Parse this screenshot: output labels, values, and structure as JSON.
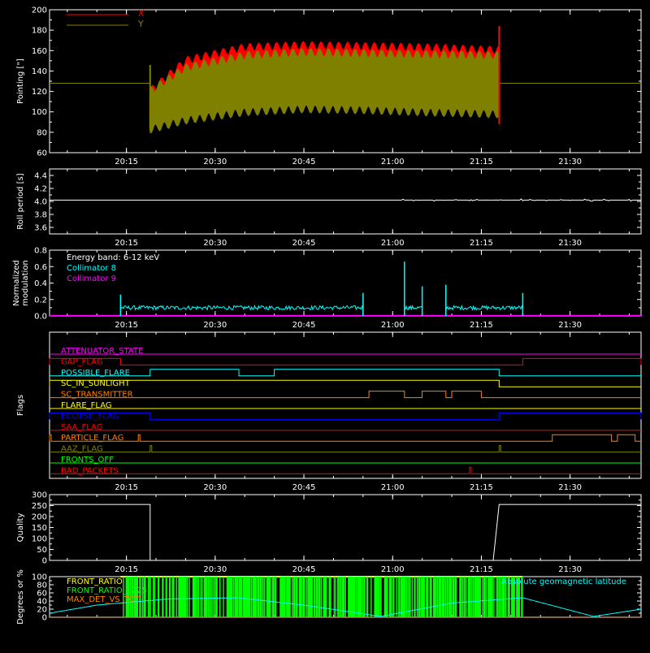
{
  "chart_data": [
    {
      "id": "pointing",
      "type": "line",
      "ylabel": "Pointing [\"]",
      "ylim": [
        60,
        200
      ],
      "yticks": [
        60,
        80,
        100,
        120,
        140,
        160,
        180,
        200
      ],
      "xlim": [
        "20:02",
        "21:42"
      ],
      "xticks": [
        "20:15",
        "20:30",
        "20:45",
        "21:00",
        "21:15",
        "21:30"
      ],
      "legend_placement": "top-left",
      "legend": [
        {
          "label": "X",
          "color": "#ff0000"
        },
        {
          "label": "Y",
          "color": "#808000"
        }
      ],
      "baseline_y": 128,
      "data_window": [
        "20:19",
        "21:18"
      ],
      "series": [
        {
          "name": "X",
          "color": "#ff0000",
          "envelope": {
            "time": [
              "20:19",
              "20:25",
              "20:35",
              "20:45",
              "20:55",
              "21:05",
              "21:18"
            ],
            "upper": [
              120,
              150,
              163,
              165,
              164,
              163,
              160
            ],
            "lower": [
              92,
              103,
              112,
              115,
              114,
              114,
              113
            ]
          }
        },
        {
          "name": "Y",
          "color": "#808000",
          "envelope": {
            "time": [
              "20:19",
              "20:25",
              "20:35",
              "20:45",
              "20:55",
              "21:05",
              "21:18"
            ],
            "upper": [
              120,
              143,
              155,
              158,
              157,
              156,
              155
            ],
            "lower": [
              83,
              92,
              100,
              103,
              102,
              100,
              98
            ]
          }
        }
      ]
    },
    {
      "id": "roll",
      "type": "line",
      "ylabel": "Roll period [s]",
      "ylim": [
        3.5,
        4.5
      ],
      "yticks": [
        3.6,
        3.8,
        4.0,
        4.2,
        4.4
      ],
      "xticks": [
        "20:15",
        "20:30",
        "20:45",
        "21:00",
        "21:15",
        "21:30"
      ],
      "series": [
        {
          "name": "",
          "color": "#ffffff",
          "constant_value": 4.02,
          "time_range": [
            "20:02",
            "21:42"
          ]
        }
      ]
    },
    {
      "id": "modulation",
      "type": "line",
      "ylabel": "Normalized modulation",
      "ylim": [
        0,
        0.8
      ],
      "yticks": [
        0.0,
        0.2,
        0.4,
        0.6,
        0.8
      ],
      "xticks": [
        "20:15",
        "20:30",
        "20:45",
        "21:00",
        "21:15",
        "21:30"
      ],
      "annotations": [
        "Energy band: 6-12 keV"
      ],
      "legend": [
        {
          "label": "Collimator 8",
          "color": "#00ffff"
        },
        {
          "label": "Collimator 9",
          "color": "#ff00ff"
        }
      ],
      "series": [
        {
          "name": "Collimator 8",
          "color": "#00ffff",
          "segments": [
            [
              "20:14",
              "20:55"
            ],
            [
              "21:02",
              "21:05"
            ],
            [
              "21:09",
              "21:22"
            ]
          ],
          "base_level": 0.1,
          "spikes": [
            {
              "time": "20:14",
              "value": 0.26
            },
            {
              "time": "20:55",
              "value": 0.28
            },
            {
              "time": "21:02",
              "value": 0.66
            },
            {
              "time": "21:05",
              "value": 0.36
            },
            {
              "time": "21:09",
              "value": 0.38
            },
            {
              "time": "21:22",
              "value": 0.28
            }
          ]
        },
        {
          "name": "Collimator 9",
          "color": "#ff00ff",
          "constant_value": 0.0,
          "time_range": [
            "20:02",
            "21:42"
          ]
        }
      ]
    },
    {
      "id": "flags",
      "type": "line",
      "ylabel": "Flags",
      "xticks": [
        "20:15",
        "20:30",
        "20:45",
        "21:00",
        "21:15",
        "21:30"
      ],
      "flags": [
        {
          "label": "ATTENUATOR_STATE",
          "color": "#ff00ff",
          "on": []
        },
        {
          "label": "GAP_FLAG",
          "color": "#ff0000",
          "on": [
            [
              "20:02",
              "20:14"
            ],
            [
              "21:22",
              "21:42"
            ]
          ]
        },
        {
          "label": "POSSIBLE_FLARE",
          "color": "#00ffff",
          "on": [
            [
              "20:19",
              "20:34"
            ],
            [
              "20:40",
              "21:18"
            ]
          ]
        },
        {
          "label": "SC_IN_SUNLIGHT",
          "color": "#ffff00",
          "on": [
            [
              "20:02",
              "21:18"
            ]
          ]
        },
        {
          "label": "SC_TRANSMITTER",
          "color": "#ff8000",
          "on": [
            [
              "20:56",
              "21:02"
            ],
            [
              "21:05",
              "21:09"
            ],
            [
              "21:10",
              "21:15"
            ]
          ]
        },
        {
          "label": "FLARE_FLAG",
          "color": "#ffff00",
          "on": []
        },
        {
          "label": "ECLIPSE_FLAG",
          "color": "#0000ff",
          "on": [
            [
              "20:02",
              "20:19"
            ],
            [
              "21:18",
              "21:42"
            ]
          ]
        },
        {
          "label": "SAA_FLAG",
          "color": "#ff0000",
          "on": []
        },
        {
          "label": "PARTICLE_FLAG",
          "color": "#ff8000",
          "on": [
            [
              "20:02",
              "20:02"
            ],
            [
              "20:17",
              "20:17"
            ],
            [
              "21:27",
              "21:37"
            ],
            [
              "21:38",
              "21:41"
            ]
          ]
        },
        {
          "label": "AAZ_FLAG",
          "color": "#808000",
          "on": [
            [
              "20:19",
              "20:19"
            ],
            [
              "21:18",
              "21:18"
            ]
          ]
        },
        {
          "label": "FRONTS_OFF",
          "color": "#00ff00",
          "on": []
        },
        {
          "label": "BAD_PACKETS",
          "color": "#ff0000",
          "on": [
            [
              "21:13",
              "21:13"
            ]
          ]
        }
      ]
    },
    {
      "id": "quality",
      "type": "line",
      "ylabel": "Quality",
      "ylim": [
        0,
        300
      ],
      "yticks": [
        0,
        50,
        100,
        150,
        200,
        250,
        300
      ],
      "xticks": [
        "20:15",
        "20:30",
        "20:45",
        "21:00",
        "21:15",
        "21:30"
      ],
      "series": [
        {
          "name": "",
          "color": "#ffffff",
          "x": [
            "20:02",
            "20:19",
            "20:19",
            "21:17",
            "21:18",
            "21:42"
          ],
          "y": [
            255,
            255,
            0,
            0,
            255,
            255
          ]
        }
      ]
    },
    {
      "id": "geomag",
      "type": "line",
      "ylabel": "Degrees or %",
      "ylim": [
        0,
        100
      ],
      "yticks": [
        0,
        20,
        40,
        60,
        80,
        100
      ],
      "legend": [
        {
          "label": "FRONT_RATIO",
          "color": "#ffff00"
        },
        {
          "label": "FRONT_RATIO_1225",
          "color": "#00ff00"
        },
        {
          "label": "MAX_DET_VS_TOT",
          "color": "#ff8000"
        }
      ],
      "annotations": [
        "Absolute geomagnetic latitude"
      ],
      "series": [
        {
          "name": "Absolute geomagnetic latitude",
          "color": "#00ffff",
          "x": [
            "20:02",
            "20:10",
            "20:22",
            "20:34",
            "20:46",
            "20:58",
            "21:10",
            "21:22",
            "21:34",
            "21:42"
          ],
          "y": [
            10,
            30,
            45,
            48,
            28,
            2,
            35,
            48,
            2,
            20
          ]
        },
        {
          "name": "FRONT_RATIO_1225",
          "color": "#00ff00",
          "time_range": [
            "20:14",
            "21:22"
          ],
          "value": 100
        }
      ]
    }
  ]
}
